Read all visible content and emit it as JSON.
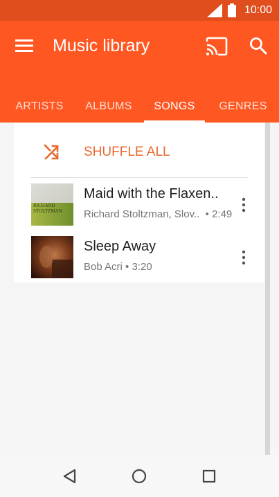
{
  "status_bar": {
    "time": "10:00",
    "signal_icon": "signal-icon",
    "battery_icon": "battery-icon"
  },
  "appbar": {
    "title": "Music library",
    "menu_icon": "menu-icon",
    "cast_icon": "cast-icon",
    "search_icon": "search-icon",
    "color": "#ff5722"
  },
  "tabs": [
    {
      "label": "ARTISTS",
      "active": false
    },
    {
      "label": "ALBUMS",
      "active": false
    },
    {
      "label": "SONGS",
      "active": true
    },
    {
      "label": "GENRES",
      "active": false
    }
  ],
  "shuffle": {
    "label": "SHUFFLE ALL",
    "icon": "shuffle-icon",
    "color": "#e8692f"
  },
  "songs": [
    {
      "title": "Maid with the Flaxen..",
      "artist": "Richard Stoltzman, Slov..",
      "duration": "2:49",
      "separator": "•",
      "art_text_line1": "RICHARD",
      "art_text_line2": "STOLTZMAN"
    },
    {
      "title": "Sleep Away",
      "artist": "Bob Acri",
      "duration": "3:20",
      "separator": "•"
    }
  ],
  "navbar": {
    "back_icon": "back-icon",
    "home_icon": "home-icon",
    "recents_icon": "recents-icon"
  }
}
